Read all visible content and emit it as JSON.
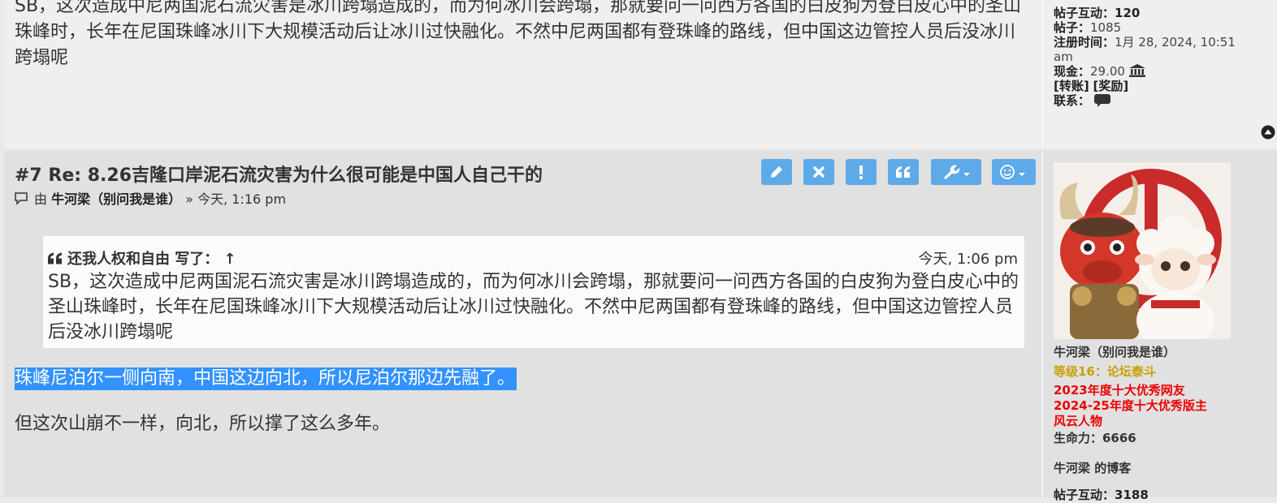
{
  "prev_post": {
    "body": "SB，这次造成中尼两国泥石流灾害是冰川跨塌造成的，而为何冰川会跨塌，那就要问一问西方各国的白皮狗为登白皮心中的圣山珠峰时，长年在尼国珠峰冰川下大规模活动后让冰川过快融化。不然中尼两国都有登珠峰的路线，但中国这边管控人员后没冰川跨塌呢",
    "profile": {
      "interact_label": "帖子互动：",
      "interact_value": "120",
      "posts_label": "帖子：",
      "posts_value": "1085",
      "reg_label": "注册时间：",
      "reg_value": "1月 28, 2024, 10:51",
      "reg_value_2": "am",
      "cash_label": "现金：",
      "cash_value": "29.00",
      "transfer_label": "[转账]",
      "reward_label": "[奖励]",
      "contact_label": "联系："
    }
  },
  "post": {
    "title": "#7 Re: 8.26吉隆口岸泥石流灾害为什么很可能是中国人自己干的",
    "by_label": "由",
    "author": "牛河梁（别问我是谁）",
    "time": "» 今天, 1:16 pm",
    "quote": {
      "author": "还我人权和自由 写了：",
      "arrow": "↑",
      "time": "今天, 1:06 pm",
      "body": "SB，这次造成中尼两国泥石流灾害是冰川跨塌造成的，而为何冰川会跨塌，那就要问一问西方各国的白皮狗为登白皮心中的圣山珠峰时，长年在尼国珠峰冰川下大规模活动后让冰川过快融化。不然中尼两国都有登珠峰的路线，但中国这边管控人员后没冰川跨塌呢"
    },
    "selected_text": "珠峰尼泊尔一侧向南，中国这边向北，所以尼泊尔那边先融了。",
    "body_text": "但这次山崩不一样，向北，所以撑了这么多年。"
  },
  "profile": {
    "name": "牛河梁（别问我是谁）",
    "rank": "等级16：论坛泰斗",
    "honors": [
      "2023年度十大优秀网友",
      "2024-25年度十大优秀版主",
      "风云人物"
    ],
    "hp": "生命力：6666",
    "blog": "牛河梁 的博客",
    "interact_label": "帖子互动：",
    "interact_value": "3188"
  },
  "colors": {
    "accent": "#5eaae8",
    "selection": "#3392ff",
    "rank": "#c8a000",
    "honor": "#e00000"
  },
  "icons": [
    "edit-icon",
    "delete-icon",
    "report-icon",
    "quote-icon",
    "wrench-icon",
    "emoji-icon",
    "bank-icon",
    "message-icon",
    "top-icon",
    "post-icon"
  ]
}
